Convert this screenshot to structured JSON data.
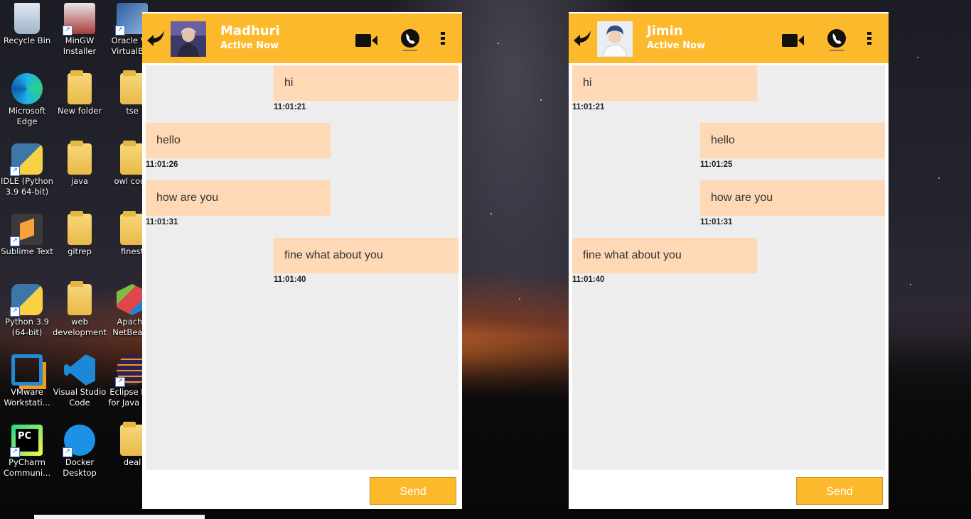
{
  "desktop": {
    "icons": [
      {
        "label": "Recycle Bin",
        "icon": "recycle-bin-icon"
      },
      {
        "label": "MinGW Installer",
        "icon": "installer-icon"
      },
      {
        "label": "Oracle VM VirtualBox",
        "icon": "virtualbox-icon"
      },
      {
        "label": "Microsoft Edge",
        "icon": "edge-icon"
      },
      {
        "label": "New folder",
        "icon": "folder-icon"
      },
      {
        "label": "tse",
        "icon": "folder-icon"
      },
      {
        "label": "IDLE (Python 3.9 64-bit)",
        "icon": "python-icon"
      },
      {
        "label": "java",
        "icon": "folder-icon"
      },
      {
        "label": "owl code",
        "icon": "folder-icon"
      },
      {
        "label": "Sublime Text",
        "icon": "sublime-icon"
      },
      {
        "label": "gitrep",
        "icon": "folder-icon"
      },
      {
        "label": "finest",
        "icon": "folder-icon"
      },
      {
        "label": "Python 3.9 (64-bit)",
        "icon": "python-icon"
      },
      {
        "label": "web development",
        "icon": "folder-icon"
      },
      {
        "label": "Apache NetBeans",
        "icon": "netbeans-icon"
      },
      {
        "label": "VMware Workstati...",
        "icon": "vmware-icon"
      },
      {
        "label": "Visual Studio Code",
        "icon": "vscode-icon"
      },
      {
        "label": "Eclipse IDE for Java D...",
        "icon": "eclipse-icon"
      },
      {
        "label": "PyCharm Communi...",
        "icon": "pycharm-icon"
      },
      {
        "label": "Docker Desktop",
        "icon": "docker-icon"
      },
      {
        "label": "deal",
        "icon": "folder-icon"
      }
    ]
  },
  "chats": [
    {
      "contact_name": "Madhuri",
      "status": "Active Now",
      "send_label": "Send",
      "messages": [
        {
          "text": "hi",
          "time": "11:01:21",
          "side": "right"
        },
        {
          "text": "hello",
          "time": "11:01:26",
          "side": "left"
        },
        {
          "text": "how are you",
          "time": "11:01:31",
          "side": "left"
        },
        {
          "text": "fine what about you",
          "time": "11:01:40",
          "side": "right"
        }
      ]
    },
    {
      "contact_name": "Jimin",
      "status": "Active Now",
      "send_label": "Send",
      "messages": [
        {
          "text": "hi",
          "time": "11:01:21",
          "side": "left"
        },
        {
          "text": "hello",
          "time": "11:01:25",
          "side": "right"
        },
        {
          "text": "how are you",
          "time": "11:01:31",
          "side": "right"
        },
        {
          "text": "fine what about you",
          "time": "11:01:40",
          "side": "left"
        }
      ]
    }
  ],
  "colors": {
    "header": "#fdb92c",
    "bubble": "#ffd9b5",
    "message_area": "#ededed"
  }
}
